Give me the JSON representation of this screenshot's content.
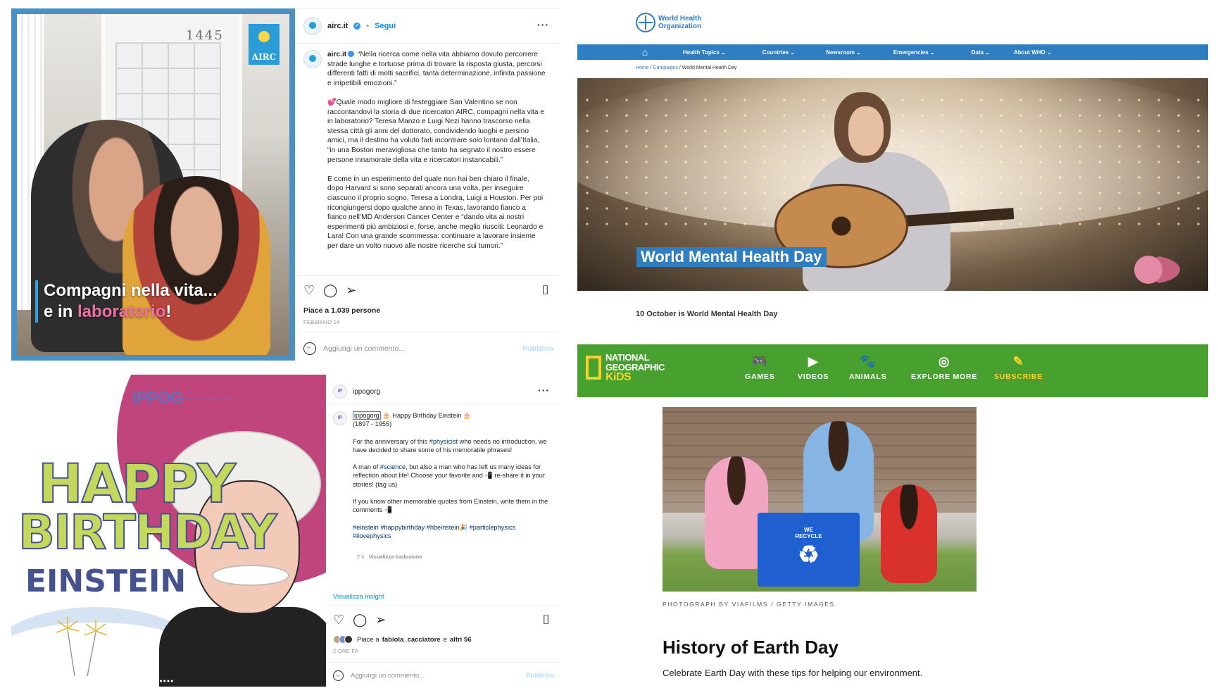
{
  "airc": {
    "image": {
      "door_number": "1445",
      "logo_text": "AIRC",
      "caption_line1": "Compagni nella vita...",
      "caption_line2_prefix": "e in ",
      "caption_line2_highlight": "laboratorio",
      "caption_line2_suffix": "!"
    },
    "header": {
      "username": "airc.it",
      "verified_mark": "✓",
      "separator": "•",
      "follow_label": "Segui",
      "more_label": "···"
    },
    "post": {
      "username": "airc.it",
      "caption": " “Nella ricerca come nella vita abbiamo dovuto percorrere strade lunghe e tortuose prima di trovare la risposta giusta, percorsi differenti fatti di molti sacrifici, tanta determinazione, infinita passione e irripetibili emozioni.”\n\n💕Quale modo migliore di festeggiare San Valentino se non raccontandovi la storia di due ricercatori AIRC, compagni nella vita e in laboratorio? Teresa Manzo e Luigi Nezi hanno trascorso nella stessa città gli anni del dottorato, condividendo luoghi e persino amici, ma il destino ha voluto farli incontrare solo lontano dall’Italia, “in una Boston meravigliosa che tanto ha segnato il nostro essere persone innamorate della vita e ricercatori instancabili.”\n\nE come in un esperimento del quale non hai ben chiaro il finale, dopo Harvard si sono separati ancora una volta, per inseguire ciascuno il proprio sogno, Teresa a Londra, Luigi a Houston. Per poi ricongiungersi dopo qualche anno in Texas, lavorando fianco a fianco nell’MD Anderson Cancer Center e “dando vita ai nostri esperimenti più ambiziosi e, forse, anche meglio riusciti: Leonardo e Lara! Con una grande scommessa: continuare a lavorare insieme per dare un volto nuovo alle nostre ricerche sui tumori.”"
    },
    "likes": "Piace a 1.039 persone",
    "date": "FEBBRAIO 14",
    "comment_placeholder": "Aggiungi un commento...",
    "publish_label": "Pubblica"
  },
  "ippog": {
    "image": {
      "logo": "IPPOG",
      "logo_sub": "International Particle Physics Outreach Group",
      "line1": "HAPPY",
      "line2": "BIRTHDAY",
      "line3": "EINSTEIN",
      "carousel_dots": "●●●●●●"
    },
    "header": {
      "username": "ippogorg",
      "more_label": "···"
    },
    "post": {
      "username": "ippogorg",
      "title": " 🎂 Happy Birthday Einstein 🎂",
      "years": "(1897 - 1955)",
      "para1_prefix": "For the anniversary of this ",
      "para1_tag": "#physicist",
      "para1_suffix": " who needs no introduction, we have decided to share some of his memorable phrases!",
      "para2_prefix": "A man of ",
      "para2_tag": "#science",
      "para2_suffix": ", but also a man who has left us many ideas for reflection about life! Choose your favorite and 📲 re-share it in your stories! (tag us)",
      "para3": "If you know other memorable quotes from Einstein, write them in the comments 📲",
      "hashtags": "#einstein #happybirthday #hbeinstein🎉 #particlephysics #ilovephysics"
    },
    "post_time": "2 h",
    "translate_label": "Visualizza traduzione",
    "insight_label": "Visualizza insight",
    "liked_prefix": "Piace a ",
    "liked_user": "fabiola_cacciatore",
    "liked_mid": " e ",
    "liked_others": "altri 56",
    "time_ago": "2 ORE FA",
    "comment_placeholder": "Aggiungi un commento...",
    "publish_label": "Pubblica"
  },
  "who": {
    "org_line1": "World Health",
    "org_line2": "Organization",
    "nav": [
      "Health Topics ⌄",
      "Countries ⌄",
      "Newsroom ⌄",
      "Emergencies ⌄",
      "Data ⌄",
      "About WHO ⌄"
    ],
    "breadcrumb": {
      "home": "Home",
      "sep": " / ",
      "campaigns": "Campaigns",
      "current": "World Mental Health Day"
    },
    "hero_title": "World Mental Health Day",
    "intro": "10 October is World Mental Health Day"
  },
  "natgeo": {
    "brand_line1": "NATIONAL",
    "brand_line2": "GEOGRAPHIC",
    "brand_line3": "KiDS",
    "nav": [
      {
        "label": "GAMES",
        "icon": "🎮"
      },
      {
        "label": "VIDEOS",
        "icon": "▶"
      },
      {
        "label": "ANIMALS",
        "icon": "🐾"
      },
      {
        "label": "EXPLORE MORE",
        "icon": "◎"
      },
      {
        "label": "SUBSCRIBE",
        "icon": "✎"
      }
    ],
    "bin_label": "WE\nRECYCLE",
    "photo_credit": "PHOTOGRAPH BY VIAFILMS / GETTY IMAGES",
    "title": "History of Earth Day",
    "subtitle": "Celebrate Earth Day with these tips for helping our environment."
  },
  "colors": {
    "instagram_blue": "#0095f6",
    "who_blue": "#2f7ec2",
    "natgeo_green": "#48a12e",
    "natgeo_yellow": "#f7d22a",
    "ippog_magenta": "#c0457c"
  }
}
